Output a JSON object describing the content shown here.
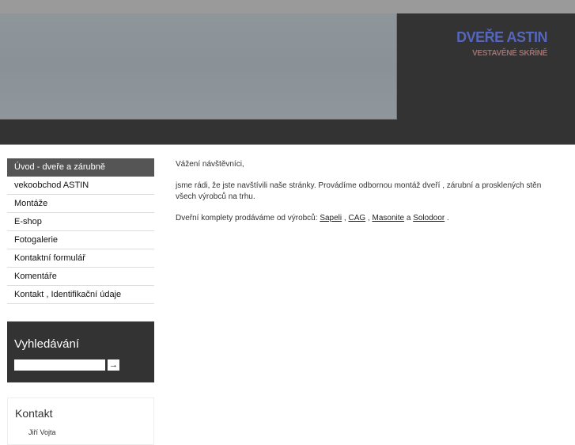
{
  "header": {
    "title": "DVEŘE ASTIN",
    "subtitle": "VESTAVĚNÉ SKŘÍNĚ"
  },
  "menu": [
    {
      "label": "Úvod - dveře a zárubně",
      "active": true
    },
    {
      "label": "vekoobchod ASTIN"
    },
    {
      "label": "Montáže"
    },
    {
      "label": "E-shop"
    },
    {
      "label": "Fotogalerie"
    },
    {
      "label": "Kontaktní formulář"
    },
    {
      "label": "Komentáře"
    },
    {
      "label": "Kontakt , Identifikační údaje"
    }
  ],
  "search": {
    "title": "Vyhledávání",
    "value": "",
    "button": "→"
  },
  "contact": {
    "title": "Kontakt",
    "item": "Jiří Vojta"
  },
  "content": {
    "greeting": "Vážení návštěvníci,",
    "para1": "jsme rádi, že jste navštívili naše stránky. Provádíme odbornou montáž dveří , zárubní a prosklených stěn všech výrobců na trhu.",
    "para2_prefix": "Dveřní komplety prodáváme od výrobců: ",
    "links": [
      "Sapeli",
      "CAG",
      "Masonite",
      "Solodoor"
    ],
    "sep1": " , ",
    "sep2": " , ",
    "sep3": " a ",
    "end": " ."
  }
}
